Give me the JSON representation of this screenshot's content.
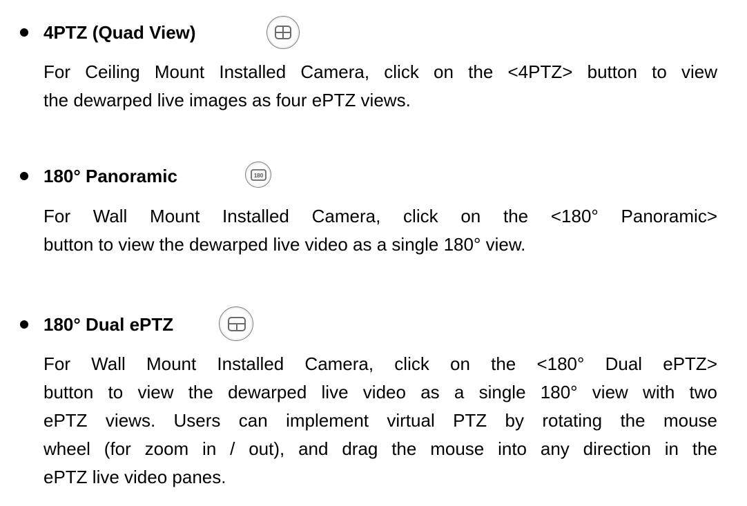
{
  "sections": [
    {
      "title": "4PTZ (Quad View)",
      "icon": "quad-view-icon",
      "description_lines": [
        "For Ceiling Mount Installed Camera, click on the <4PTZ> button to view",
        "the dewarped live images as four ePTZ views."
      ]
    },
    {
      "title": "180° Panoramic",
      "icon": "panoramic-180-icon",
      "icon_label": "180",
      "description_lines": [
        "For Wall Mount Installed Camera, click on the <180° Panoramic>",
        "button to view the dewarped live video as a single 180° view."
      ]
    },
    {
      "title": "180° Dual ePTZ",
      "icon": "dual-eptz-icon",
      "description_lines": [
        "For Wall Mount Installed Camera, click on the <180° Dual ePTZ>",
        "button to view the dewarped live video as a single 180° view with two",
        "ePTZ views. Users can implement virtual PTZ by rotating the mouse",
        "wheel (for zoom in / out), and drag the mouse into any direction in the",
        "ePTZ live video panes."
      ]
    }
  ]
}
